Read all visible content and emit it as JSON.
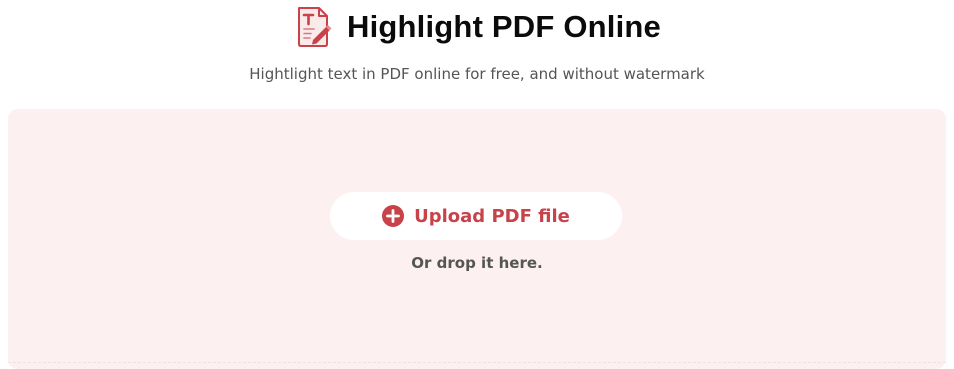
{
  "header": {
    "title": "Highlight PDF Online",
    "subtitle": "Hightlight text in PDF online for free, and without watermark",
    "logo_icon": "pdf-highlight-icon"
  },
  "upload": {
    "button_label": "Upload PDF file",
    "button_icon": "plus-circle-icon",
    "drop_hint": "Or drop it here."
  },
  "colors": {
    "accent": "#c8424a",
    "dropzone_background": "#fdf0f0",
    "title_text": "#0b0b0b",
    "secondary_text": "#555555"
  }
}
